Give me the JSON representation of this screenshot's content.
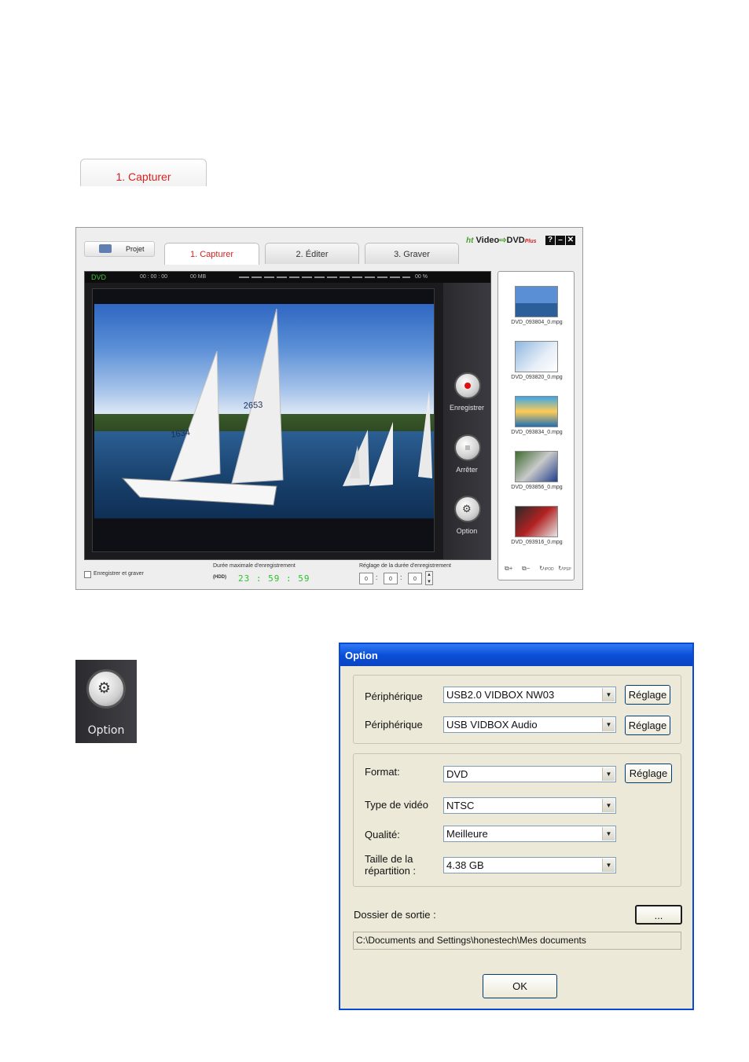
{
  "lone_tab": {
    "label": "1. Capturer"
  },
  "app": {
    "projet_label": "Projet",
    "tabs": [
      "1. Capturer",
      "2.  Éditer",
      "3. Graver"
    ],
    "logo": {
      "text": "Video",
      "dvd": "DVD",
      "plus": "Plus"
    },
    "window_buttons": [
      "?",
      "–",
      "✕"
    ],
    "status": {
      "format": "DVD",
      "time": "00 : 00 : 00",
      "size": "00 MB",
      "percent": "00 %"
    },
    "sail_numbers": [
      "2653",
      "1634"
    ],
    "controls": {
      "record": "Enregistrer",
      "stop": "Arrêter",
      "option": "Option"
    },
    "files": [
      "DVD_093804_0.mpg",
      "DVD_093820_0.mpg",
      "DVD_093834_0.mpg",
      "DVD_093856_0.mpg",
      "DVD_093916_0.mpg"
    ],
    "panel_tools": {
      "ipod": "iPOD",
      "psp": "PSP"
    },
    "bottom": {
      "record_burn": "Enregistrer et graver",
      "max_duration_label": "Durée maximale d'enregistrement",
      "hdd": "(HDD)",
      "max_duration": "23 : 59 : 59",
      "duration_setting_label": "Réglage de la durée d'enregistrement",
      "duration_values": [
        "0",
        "0",
        "0"
      ]
    }
  },
  "option_crop": {
    "label": "Option"
  },
  "dialog": {
    "title": "Option",
    "device1_label": "Périphérique",
    "device1_value": "USB2.0 VIDBOX NW03",
    "device2_label": "Périphérique",
    "device2_value": "USB VIDBOX Audio",
    "setting_label": "Réglage",
    "format_label": "Format:",
    "format_value": "DVD",
    "video_type_label": "Type de vidéo",
    "video_type_value": "NTSC",
    "quality_label": "Qualité:",
    "quality_value": "Meilleure",
    "split_label_1": "Taille de la",
    "split_label_2": "répartition :",
    "split_value": "4.38 GB",
    "output_folder_label": "Dossier de sortie :",
    "browse_label": "...",
    "output_path": "C:\\Documents and Settings\\honestech\\Mes documents",
    "ok_label": "OK"
  }
}
